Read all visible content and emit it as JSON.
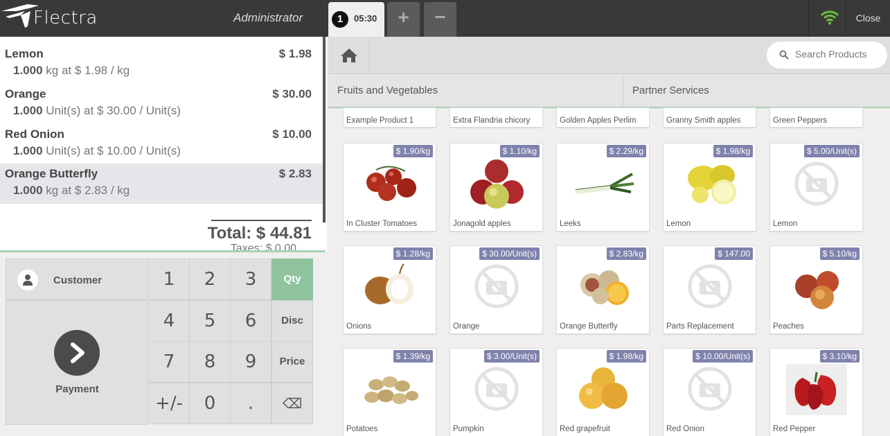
{
  "header": {
    "logo": "Flectra",
    "user": "Administrator",
    "order_number": "1",
    "order_time": "05:30",
    "add_order": "+",
    "remove_order": "−",
    "close": "Close"
  },
  "order": {
    "lines": [
      {
        "name": "Lemon",
        "price": "$ 1.98",
        "qty": "1.000",
        "detail": "kg at $ 1.98 / kg"
      },
      {
        "name": "Orange",
        "price": "$ 30.00",
        "qty": "1.000",
        "detail": "Unit(s) at $ 30.00 / Unit(s)"
      },
      {
        "name": "Red Onion",
        "price": "$ 10.00",
        "qty": "1.000",
        "detail": "Unit(s) at $ 10.00 / Unit(s)"
      },
      {
        "name": "Orange Butterfly",
        "price": "$ 2.83",
        "qty": "1.000",
        "detail": "kg at $ 2.83 / kg"
      }
    ],
    "total": "Total: $ 44.81",
    "taxes": "Taxes: $ 0.00"
  },
  "actionpad": {
    "customer": "Customer",
    "payment": "Payment"
  },
  "numpad": {
    "keys": [
      "1",
      "2",
      "3",
      "Qty",
      "4",
      "5",
      "6",
      "Disc",
      "7",
      "8",
      "9",
      "Price",
      "+/-",
      "0",
      ".",
      "⌫"
    ],
    "active_mode": "Qty"
  },
  "products_screen": {
    "search_placeholder": "Search Products",
    "categories": [
      "Fruits and Vegetables",
      "Partner Services"
    ],
    "top_row": [
      "Example Product 1",
      "Extra Flandria chicory",
      "Golden Apples Perlim",
      "Granny Smith apples",
      "Green Peppers"
    ],
    "products": [
      {
        "name": "In Cluster Tomatoes",
        "price": "$ 1.90/kg",
        "icon": "tomatoes"
      },
      {
        "name": "Jonagold apples",
        "price": "$ 1.10/kg",
        "icon": "apples"
      },
      {
        "name": "Leeks",
        "price": "$ 2.29/kg",
        "icon": "leeks"
      },
      {
        "name": "Lemon",
        "price": "$ 1.98/kg",
        "icon": "lemons"
      },
      {
        "name": "Lemon",
        "price": "$ 5.00/Unit(s)",
        "icon": "no-image"
      },
      {
        "name": "Onions",
        "price": "$ 1.28/kg",
        "icon": "onions"
      },
      {
        "name": "Orange",
        "price": "$ 30.00/Unit(s)",
        "icon": "no-image"
      },
      {
        "name": "Orange Butterfly",
        "price": "$ 2.83/kg",
        "icon": "orange-butterfly"
      },
      {
        "name": "Parts Replacement",
        "price": "$ 147.00",
        "icon": "no-image"
      },
      {
        "name": "Peaches",
        "price": "$ 5.10/kg",
        "icon": "peaches"
      },
      {
        "name": "Potatoes",
        "price": "$ 1.39/kg",
        "icon": "potatoes"
      },
      {
        "name": "Pumpkin",
        "price": "$ 3.00/Unit(s)",
        "icon": "no-image"
      },
      {
        "name": "Red grapefruit",
        "price": "$ 1.98/kg",
        "icon": "grapefruit"
      },
      {
        "name": "Red Onion",
        "price": "$ 10.00/Unit(s)",
        "icon": "no-image"
      },
      {
        "name": "Red Pepper",
        "price": "$ 3.10/kg",
        "icon": "red-pepper"
      }
    ]
  },
  "colors": {
    "topbar": "#393939",
    "accent_green": "#8fc39e",
    "price_badge": "#7f82ac"
  }
}
